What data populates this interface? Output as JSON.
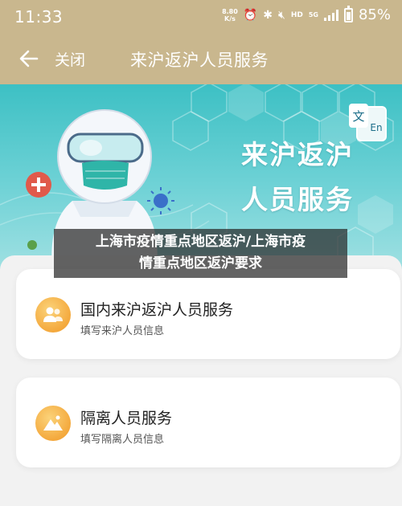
{
  "status_bar": {
    "time": "11:33",
    "net_speed_value": "8.80",
    "net_speed_unit": "K/s",
    "hd_label": "HD",
    "network_label": "5G",
    "battery": "85%"
  },
  "title_bar": {
    "close_label": "关闭",
    "title": "来沪返沪人员服务"
  },
  "banner": {
    "line1": "来沪返沪",
    "line2": "人员服务",
    "lang_badge_cn": "文",
    "lang_badge_en": "En"
  },
  "headline": {
    "line1": "上海市疫情重点地区返沪/上海市疫",
    "line2": "情重点地区返沪要求"
  },
  "services": [
    {
      "title": "国内来沪返沪人员服务",
      "subtitle": "填写来沪人员信息",
      "icon": "people-icon"
    },
    {
      "title": "隔离人员服务",
      "subtitle": "填写隔离人员信息",
      "icon": "mountain-icon"
    }
  ],
  "colors": {
    "header": "#c9b78e",
    "banner": "#3dc0c4",
    "icon_orange": "#f4a93d"
  }
}
